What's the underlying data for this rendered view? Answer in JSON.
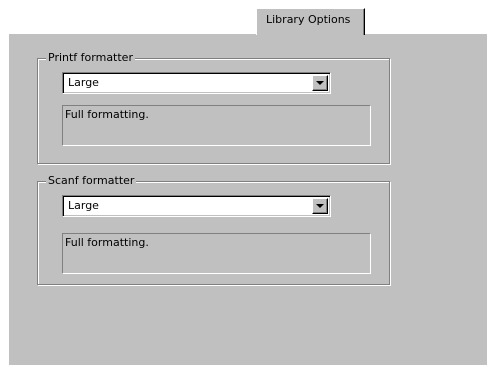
{
  "tab": {
    "label": "Library Options"
  },
  "printf": {
    "legend": "Printf formatter",
    "selected": "Large",
    "description": "Full formatting."
  },
  "scanf": {
    "legend": "Scanf formatter",
    "selected": "Large",
    "description": "Full formatting."
  },
  "icons": {
    "dropdown": "chevron-down-icon"
  },
  "colors": {
    "face": "#c0c0c0",
    "highlight": "#ffffff",
    "shadow": "#808080",
    "dark_shadow": "#000000"
  }
}
